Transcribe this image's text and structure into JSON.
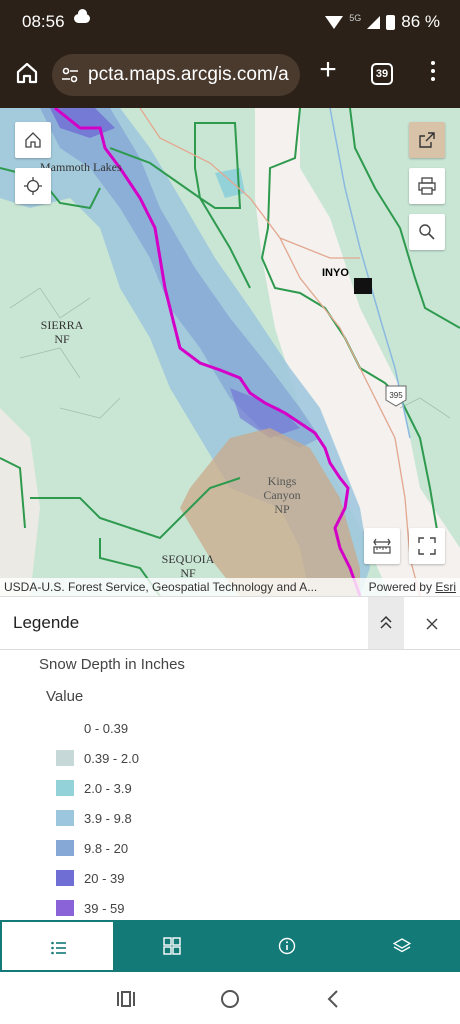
{
  "status_bar": {
    "time": "08:56",
    "network": "5G",
    "battery": "86 %"
  },
  "browser": {
    "url": "pcta.maps.arcgis.com/a",
    "tab_count": "39"
  },
  "map": {
    "labels": {
      "mammoth": "Mammoth Lakes",
      "inyo": "INYO",
      "sierra": "SIERRA\nNF",
      "kings": "Kings\nCanyon\nNP",
      "sequoia": "SEQUOIA\nNF",
      "highway": "395"
    },
    "attribution": "USDA-U.S. Forest Service, Geospatial Technology and A...",
    "powered_by": "Powered by",
    "powered_by_link": "Esri",
    "colors": {
      "forest": "#c9e6d5",
      "boundary": "#2e9a4e",
      "trail": "#d400c8",
      "valley": "#f4f1ee"
    }
  },
  "legend": {
    "title": "Legende",
    "layer": "Snow Depth in Inches",
    "field": "Value",
    "classes": [
      {
        "label": "0 - 0.39",
        "color": "#ffffff"
      },
      {
        "label": "0.39 - 2.0",
        "color": "#c6d8d8"
      },
      {
        "label": "2.0 - 3.9",
        "color": "#94d2d9"
      },
      {
        "label": "3.9 - 9.8",
        "color": "#9cc6dd"
      },
      {
        "label": "9.8 - 20",
        "color": "#86a8d6"
      },
      {
        "label": "20 - 39",
        "color": "#6f6ed5"
      },
      {
        "label": "39 - 59",
        "color": "#8b63d8"
      }
    ]
  },
  "tabs": [
    {
      "name": "legend",
      "active": true
    },
    {
      "name": "basemap",
      "active": false
    },
    {
      "name": "info",
      "active": false
    },
    {
      "name": "layers",
      "active": false
    }
  ]
}
